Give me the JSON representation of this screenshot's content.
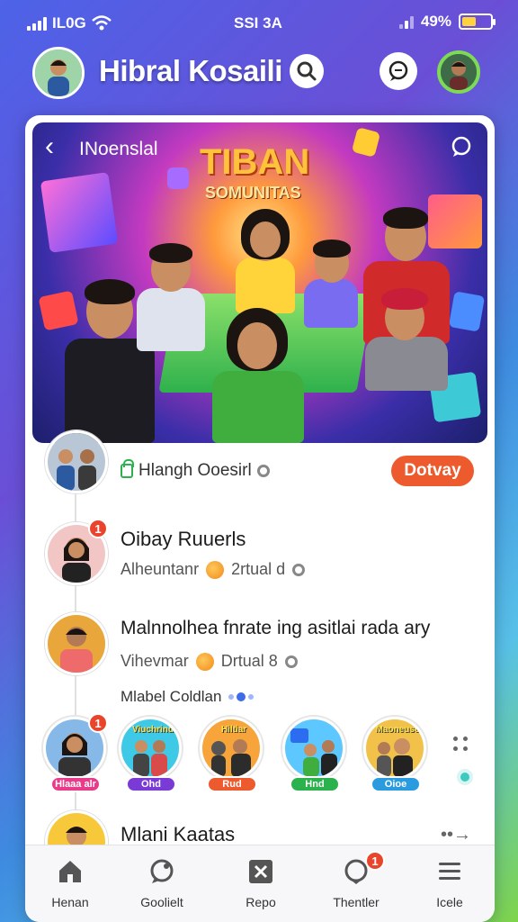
{
  "status_bar": {
    "network": "IL0G",
    "time": "SSI 3A",
    "battery": "49%",
    "battery_level": 0.49,
    "battery_color": "#ffd23f"
  },
  "header": {
    "title": "Hibral Kosaili"
  },
  "hero": {
    "label": "INoenslal",
    "title": "TIBAN",
    "subtitle": "SOMUNITAS"
  },
  "rows": [
    {
      "title": "Hlangh Ooesirl",
      "action": "Dotvay"
    },
    {
      "title": "Oibay Ruuerls",
      "subtitle": "Alheuntanr",
      "meta": "2rtual d",
      "badge": "1"
    },
    {
      "title": "Malnnolhea fnrate ing asitlai rada ary",
      "subtitle": "Vihevmar",
      "meta": "Drtual 8"
    },
    {
      "title": "Mlani Kaatas"
    }
  ],
  "section_label": "Mlabel Coldlan",
  "stories": [
    {
      "caption": "",
      "tag": "Hlaaa alr",
      "badge": "1",
      "tag_color": "#e83b8a"
    },
    {
      "caption": "Viuchrind",
      "tag": "Ohd",
      "tag_color": "#7a3ad6"
    },
    {
      "caption": "Hiltiar",
      "tag": "Rud",
      "tag_color": "#ec5a2e"
    },
    {
      "caption": "",
      "tag": "Hnd",
      "tag_color": "#2bb24c"
    },
    {
      "caption": "Maoneuse",
      "tag": "Oioe",
      "tag_color": "#2b9be0"
    }
  ],
  "nav": [
    {
      "label": "Henan",
      "icon": "home-icon"
    },
    {
      "label": "Goolielt",
      "icon": "chat-bubble-icon"
    },
    {
      "label": "Repo",
      "icon": "tools-icon"
    },
    {
      "label": "Thentler",
      "icon": "notification-icon",
      "badge": "1"
    },
    {
      "label": "Icele",
      "icon": "menu-icon"
    }
  ],
  "colors": {
    "accent": "#ec5a2e",
    "brand_green": "#7ed957",
    "nav_badge": "#e8452c"
  }
}
